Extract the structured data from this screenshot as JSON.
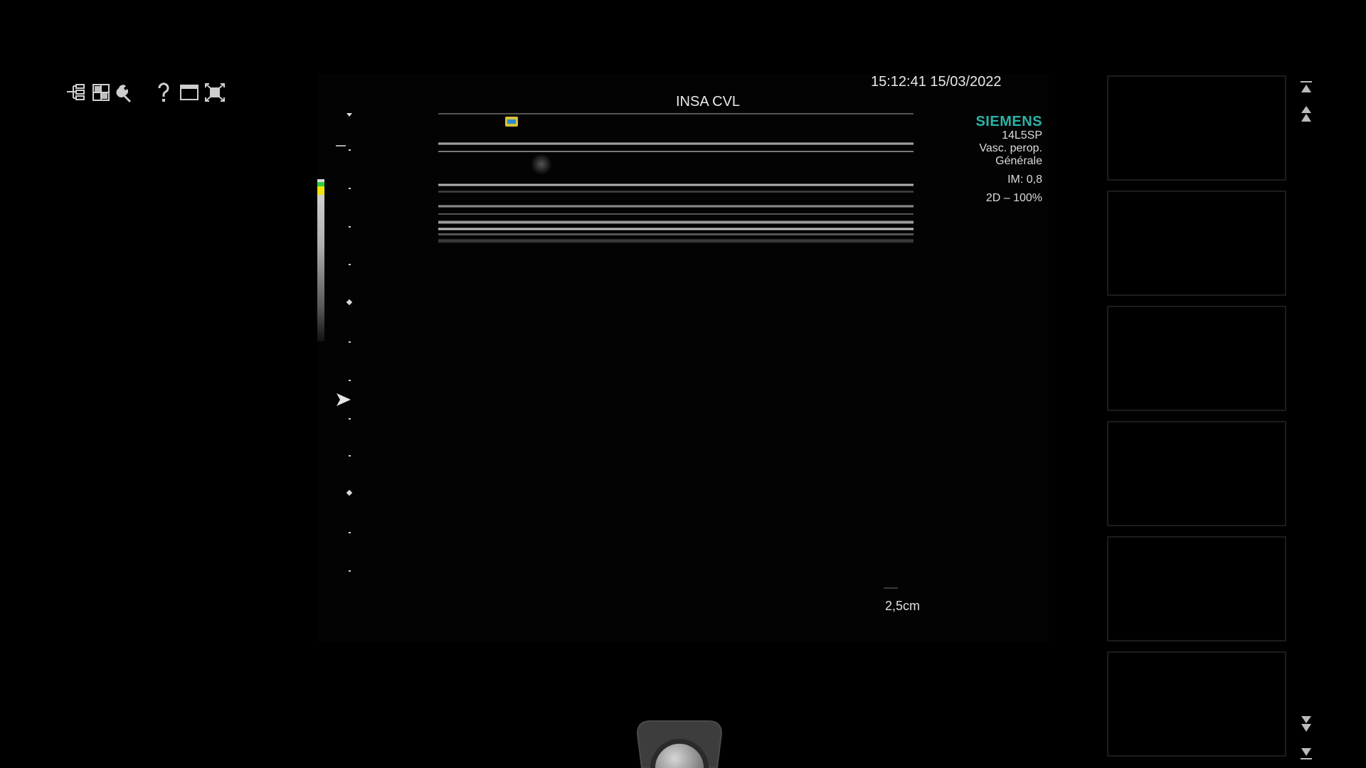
{
  "app": {
    "timestamp": "15:12:41 15/03/2022",
    "institution": "INSA CVL"
  },
  "toolbar": {
    "tools": [
      {
        "name": "patient-tree-icon"
      },
      {
        "name": "layout-grid-icon"
      },
      {
        "name": "wrench-icon"
      },
      {
        "name": "help-icon"
      },
      {
        "name": "window-icon"
      },
      {
        "name": "fullscreen-icon"
      }
    ]
  },
  "info": {
    "brand": "SIEMENS",
    "transducer": "14L5SP",
    "preset": "Vasc. perop.",
    "subpreset": "Générale",
    "mechanical_index": "IM: 0,8",
    "mode": "2D – 100%",
    "brand_color": "#2bb3a8"
  },
  "image": {
    "depth": "2,5cm"
  },
  "thumbnails": {
    "count": 6
  },
  "colors": {
    "background": "#000000",
    "text": "#e8e8e8",
    "yellow_marker": "#f0e30a"
  }
}
